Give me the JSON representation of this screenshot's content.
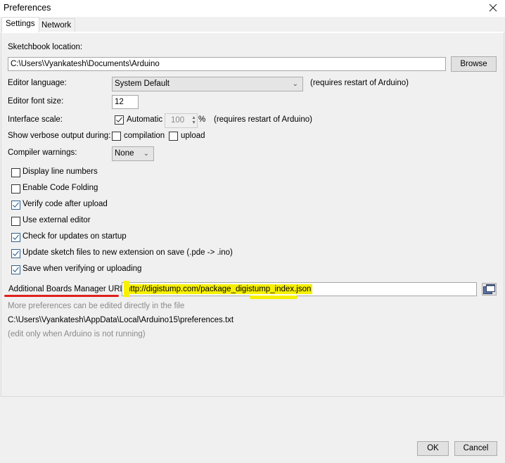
{
  "window": {
    "title": "Preferences",
    "close_icon": "close-icon"
  },
  "tabs": [
    {
      "label": "Settings",
      "active": true
    },
    {
      "label": "Network",
      "active": false
    }
  ],
  "settings": {
    "sketchbook": {
      "label": "Sketchbook location:",
      "value": "C:\\Users\\Vyankatesh\\Documents\\Arduino",
      "browse_label": "Browse"
    },
    "editor_language": {
      "label": "Editor language:",
      "value": "System Default",
      "note": "(requires restart of Arduino)"
    },
    "editor_font_size": {
      "label": "Editor font size:",
      "value": "12"
    },
    "interface_scale": {
      "label": "Interface scale:",
      "automatic_label": "Automatic",
      "automatic_checked": true,
      "value": "100",
      "unit": "%",
      "note": "(requires restart of Arduino)"
    },
    "verbose_output": {
      "label": "Show verbose output during:",
      "compilation_label": "compilation",
      "compilation_checked": false,
      "upload_label": "upload",
      "upload_checked": false
    },
    "compiler_warnings": {
      "label": "Compiler warnings:",
      "value": "None"
    },
    "checkboxes": [
      {
        "label": "Display line numbers",
        "checked": false
      },
      {
        "label": "Enable Code Folding",
        "checked": false
      },
      {
        "label": "Verify code after upload",
        "checked": true
      },
      {
        "label": "Use external editor",
        "checked": false
      },
      {
        "label": "Check for updates on startup",
        "checked": true
      },
      {
        "label": "Update sketch files to new extension on save (.pde -> .ino)",
        "checked": true
      },
      {
        "label": "Save when verifying or uploading",
        "checked": true
      }
    ],
    "boards_manager": {
      "label": "Additional Boards Manager URLs:",
      "value": "http://digistump.com/package_digistump_index.json",
      "annotation_underline_color": "#e0201c",
      "annotation_highlight_color": "#f7f000"
    },
    "more_prefs_note": "More preferences can be edited directly in the file",
    "prefs_path": "C:\\Users\\Vyankatesh\\AppData\\Local\\Arduino15\\preferences.txt",
    "edit_note": "(edit only when Arduino is not running)"
  },
  "footer": {
    "ok_label": "OK",
    "cancel_label": "Cancel"
  }
}
